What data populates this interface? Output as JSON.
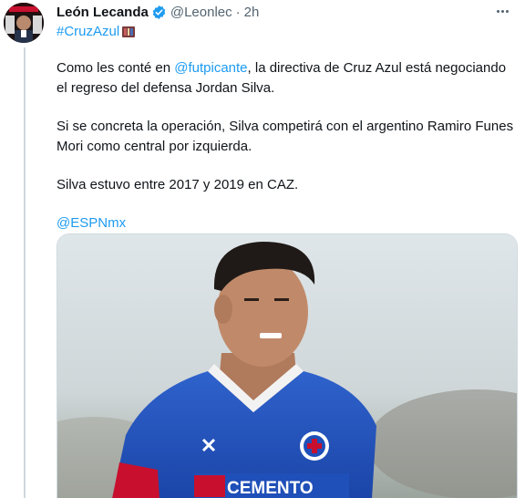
{
  "author": {
    "display_name": "León Lecanda",
    "handle": "@Leonlec",
    "separator": "·",
    "time": "2h",
    "verified": true,
    "avatar_icon": "profile-photo"
  },
  "hashtag": "#CruzAzul",
  "body": {
    "p1": {
      "before": "Como les conté en ",
      "mention": "@futpicante",
      "after": ", la directiva de Cruz Azul está negociando el regreso del defensa Jordan Silva."
    },
    "p2": "Si se concreta la operación, Silva competirá con el argentino Ramiro Funes Mori como central por izquierda.",
    "p3": "Silva estuvo entre 2017 y 2019 en CAZ.",
    "p4_mention": "@ESPNmx"
  },
  "media": {
    "jersey_text": "CEMENTO",
    "alt_icon": "player-photo"
  },
  "colors": {
    "link": "#1d9bf0",
    "text": "#0f1419",
    "secondary": "#536471",
    "jersey_blue": "#1f4fb8"
  }
}
